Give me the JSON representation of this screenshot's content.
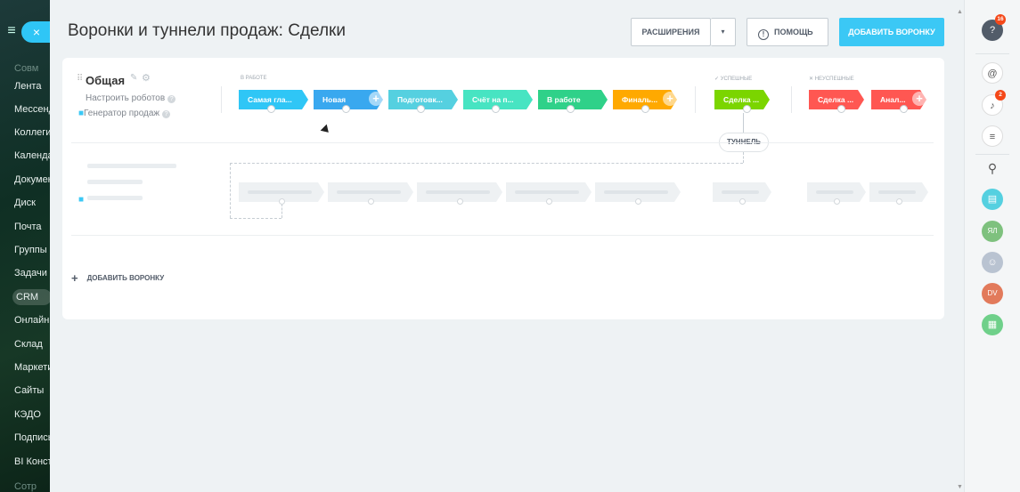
{
  "left_sidebar": {
    "close_label": "×",
    "menu_icon": "≡",
    "items": [
      {
        "label": "Совм",
        "active": false,
        "dim": true
      },
      {
        "label": "Лента",
        "active": false,
        "dim": false
      },
      {
        "label": "Мессенджер",
        "active": false,
        "dim": false
      },
      {
        "label": "Коллеги",
        "active": false,
        "dim": false
      },
      {
        "label": "Календарь",
        "active": false,
        "dim": false
      },
      {
        "label": "Документы",
        "active": false,
        "dim": false
      },
      {
        "label": "Диск",
        "active": false,
        "dim": false
      },
      {
        "label": "Почта",
        "active": false,
        "dim": false
      },
      {
        "label": "Группы",
        "active": false,
        "dim": false
      },
      {
        "label": "Задачи",
        "active": false,
        "dim": false
      },
      {
        "label": "CRM",
        "active": true,
        "dim": false
      },
      {
        "label": "Онлайн",
        "active": false,
        "dim": false
      },
      {
        "label": "Склад",
        "active": false,
        "dim": false
      },
      {
        "label": "Маркетинг",
        "active": false,
        "dim": false
      },
      {
        "label": "Сайты",
        "active": false,
        "dim": false
      },
      {
        "label": "КЭДО",
        "active": false,
        "dim": false
      },
      {
        "label": "Подпись",
        "active": false,
        "dim": false
      },
      {
        "label": "BI Конструктор",
        "active": false,
        "dim": false
      },
      {
        "label": "Сотр",
        "active": false,
        "dim": true
      }
    ]
  },
  "header": {
    "title": "Воронки и туннели продаж: Сделки",
    "extensions_label": "РАСШИРЕНИЯ",
    "caret": "▾",
    "help_label": "ПОМОЩЬ",
    "help_icon": "!",
    "add_funnel_label": "ДОБАВИТЬ ВОРОНКУ"
  },
  "funnel": {
    "name": "Общая",
    "drag_icon": "⠿",
    "edit_icon": "✎",
    "settings_icon": "⚙",
    "robots_link": "Настроить роботов",
    "generator_link": "Генератор продаж",
    "help_icon": "?",
    "lock_icon": "🔒",
    "groups": {
      "in_work": "В РАБОТЕ",
      "success": "✓ УСПЕШНЫЕ",
      "fail": "✕ НЕУСПЕШНЫЕ"
    },
    "stages": [
      {
        "label": "Самая гла...",
        "color": "#2fc6f6"
      },
      {
        "label": "Новая",
        "color": "#39a8ef"
      },
      {
        "label": "Подготовк...",
        "color": "#55d0e0"
      },
      {
        "label": "Счёт на п...",
        "color": "#47e4c2"
      },
      {
        "label": "В работе",
        "color": "#2fd189"
      },
      {
        "label": "Финаль...",
        "color": "#ffa900"
      },
      {
        "label": "Сделка ...",
        "color": "#7bd500"
      },
      {
        "label": "Сделка ...",
        "color": "#ff5752"
      },
      {
        "label": "Анал...",
        "color": "#ff5752"
      }
    ],
    "plus_icon": "+",
    "tunnel_label": "ТУННЕЛЬ"
  },
  "add_funnel_link": {
    "plus": "+",
    "label": "ДОБАВИТЬ ВОРОНКУ"
  },
  "right_sidebar": {
    "help_badge": "16",
    "bell_badge": "2",
    "avatar_yl": "ЯЛ",
    "avatar_dv": "DV",
    "search_icon": "⚲"
  }
}
